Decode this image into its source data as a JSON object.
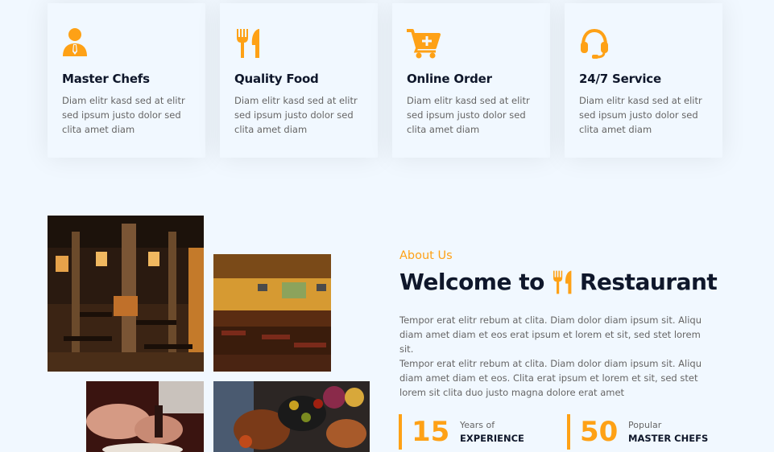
{
  "services": [
    {
      "icon": "user-tie-icon",
      "title": "Master Chefs",
      "text": "Diam elitr kasd sed at elitr sed ipsum justo dolor sed clita amet diam"
    },
    {
      "icon": "utensils-icon",
      "title": "Quality Food",
      "text": "Diam elitr kasd sed at elitr sed ipsum justo dolor sed clita amet diam"
    },
    {
      "icon": "cart-plus-icon",
      "title": "Online Order",
      "text": "Diam elitr kasd sed at elitr sed ipsum justo dolor sed clita amet diam"
    },
    {
      "icon": "headset-icon",
      "title": "24/7 Service",
      "text": "Diam elitr kasd sed at elitr sed ipsum justo dolor sed clita amet diam"
    }
  ],
  "about": {
    "label": "About Us",
    "title_before": "Welcome to",
    "title_after": "Restaurant",
    "para1": "Tempor erat elitr rebum at clita. Diam dolor diam ipsum sit. Aliqu diam amet diam et eos erat ipsum et lorem et sit, sed stet lorem sit.",
    "para2": "Tempor erat elitr rebum at clita. Diam dolor diam ipsum sit. Aliqu diam amet diam et eos. Clita erat ipsum et lorem et sit, sed stet lorem sit clita duo justo magna dolore erat amet",
    "stats": [
      {
        "number": "15",
        "label_top": "Years of",
        "label_bottom": "EXPERIENCE"
      },
      {
        "number": "50",
        "label_top": "Popular",
        "label_bottom": "MASTER CHEFS"
      }
    ]
  },
  "colors": {
    "accent": "#fea116",
    "dark": "#0f172b",
    "background": "#f1f8ff",
    "text": "#666565"
  }
}
